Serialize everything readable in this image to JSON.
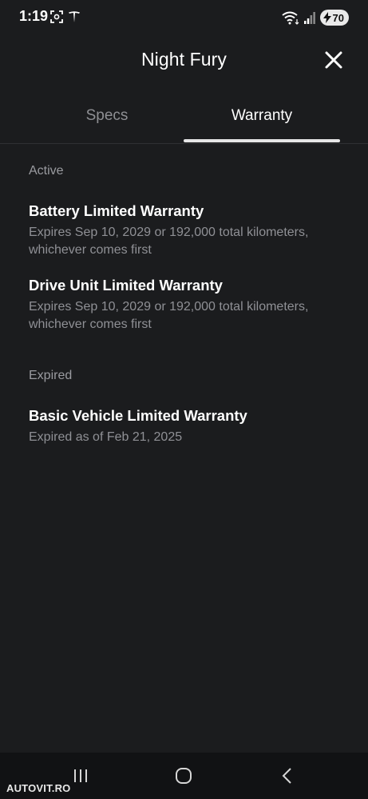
{
  "status_bar": {
    "time": "1:19",
    "battery_level": "70",
    "icons": [
      "screenshot-icon",
      "tesla-logo-icon",
      "wifi-icon",
      "signal-icon",
      "battery-charging-icon"
    ]
  },
  "header": {
    "title": "Night Fury",
    "close_icon": "close-icon"
  },
  "tabs": [
    {
      "label": "Specs",
      "selected": false
    },
    {
      "label": "Warranty",
      "selected": true
    }
  ],
  "sections": {
    "active": {
      "label": "Active",
      "items": [
        {
          "title": "Battery Limited Warranty",
          "description": "Expires Sep 10, 2029 or 192,000 total kilometers, whichever comes first"
        },
        {
          "title": "Drive Unit Limited Warranty",
          "description": "Expires Sep 10, 2029 or 192,000 total kilometers, whichever comes first"
        }
      ]
    },
    "expired": {
      "label": "Expired",
      "items": [
        {
          "title": "Basic Vehicle Limited Warranty",
          "description": "Expired as of Feb 21, 2025"
        }
      ]
    }
  },
  "nav_bar": {
    "icons": [
      "recent-apps-icon",
      "home-icon",
      "back-icon"
    ]
  },
  "watermark": "AUTOVIT.RO",
  "colors": {
    "background": "#1b1c1e",
    "text_primary": "#ffffff",
    "text_secondary": "#8f9095",
    "tab_underline": "#e6e6e6"
  }
}
